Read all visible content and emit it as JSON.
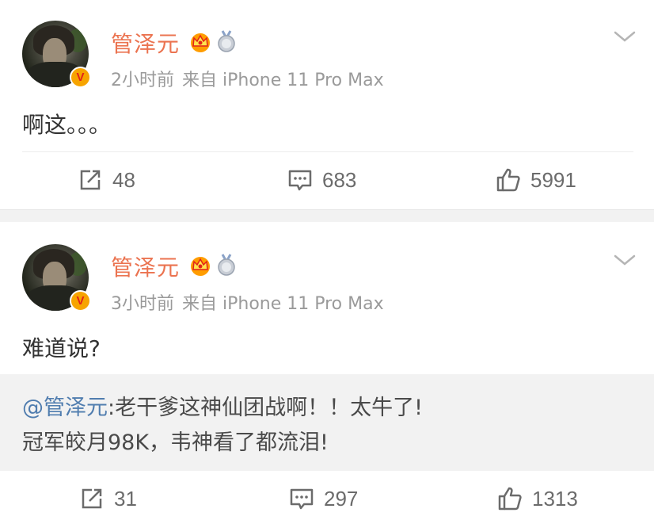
{
  "posts": [
    {
      "username": "管泽元",
      "time": "2小时前",
      "source": "来自 iPhone 11 Pro Max",
      "text": "啊这。。。",
      "actions": {
        "repost": "48",
        "comment": "683",
        "like": "5991"
      }
    },
    {
      "username": "管泽元",
      "time": "3小时前",
      "source": "来自 iPhone 11 Pro Max",
      "text": "难道说?",
      "quote": {
        "mention": "@管泽元",
        "line1_rest": ":老干爹这神仙团战啊！！太牛了!",
        "line2": "冠军皎月98K，韦神看了都流泪!"
      },
      "actions": {
        "repost": "31",
        "comment": "297",
        "like": "1313"
      }
    }
  ],
  "badges": {
    "verified": "V"
  },
  "icons": {
    "crown": "crown-icon",
    "medal": "medal-icon",
    "repost": "repost-icon",
    "comment": "comment-icon",
    "like": "like-icon",
    "menu": "chevron-down-icon"
  },
  "colors": {
    "username": "#eb7350",
    "mention": "#507daf",
    "verified_badge": "#f7a400"
  }
}
